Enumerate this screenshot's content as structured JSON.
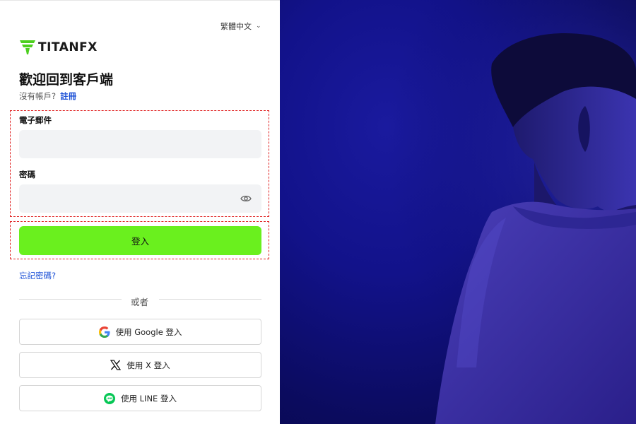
{
  "language": {
    "label": "繁體中文"
  },
  "logo": {
    "text": "TITANFX"
  },
  "header": {
    "title": "歡迎回到客戶端"
  },
  "register": {
    "prompt": "沒有帳戶?",
    "link": "註冊"
  },
  "form": {
    "email_label": "電子郵件",
    "email_value": "",
    "password_label": "密碼",
    "password_value": "",
    "login_label": "登入"
  },
  "forgot_password": "忘記密碼?",
  "divider": {
    "or": "或者"
  },
  "social": {
    "google": "使用 Google 登入",
    "x": "使用 X 登入",
    "line": "使用 LINE 登入"
  },
  "colors": {
    "accent_green": "#6af01e",
    "link_blue": "#1a4fd6",
    "highlight_red": "#e02020",
    "photo_bg": "#12128a"
  }
}
